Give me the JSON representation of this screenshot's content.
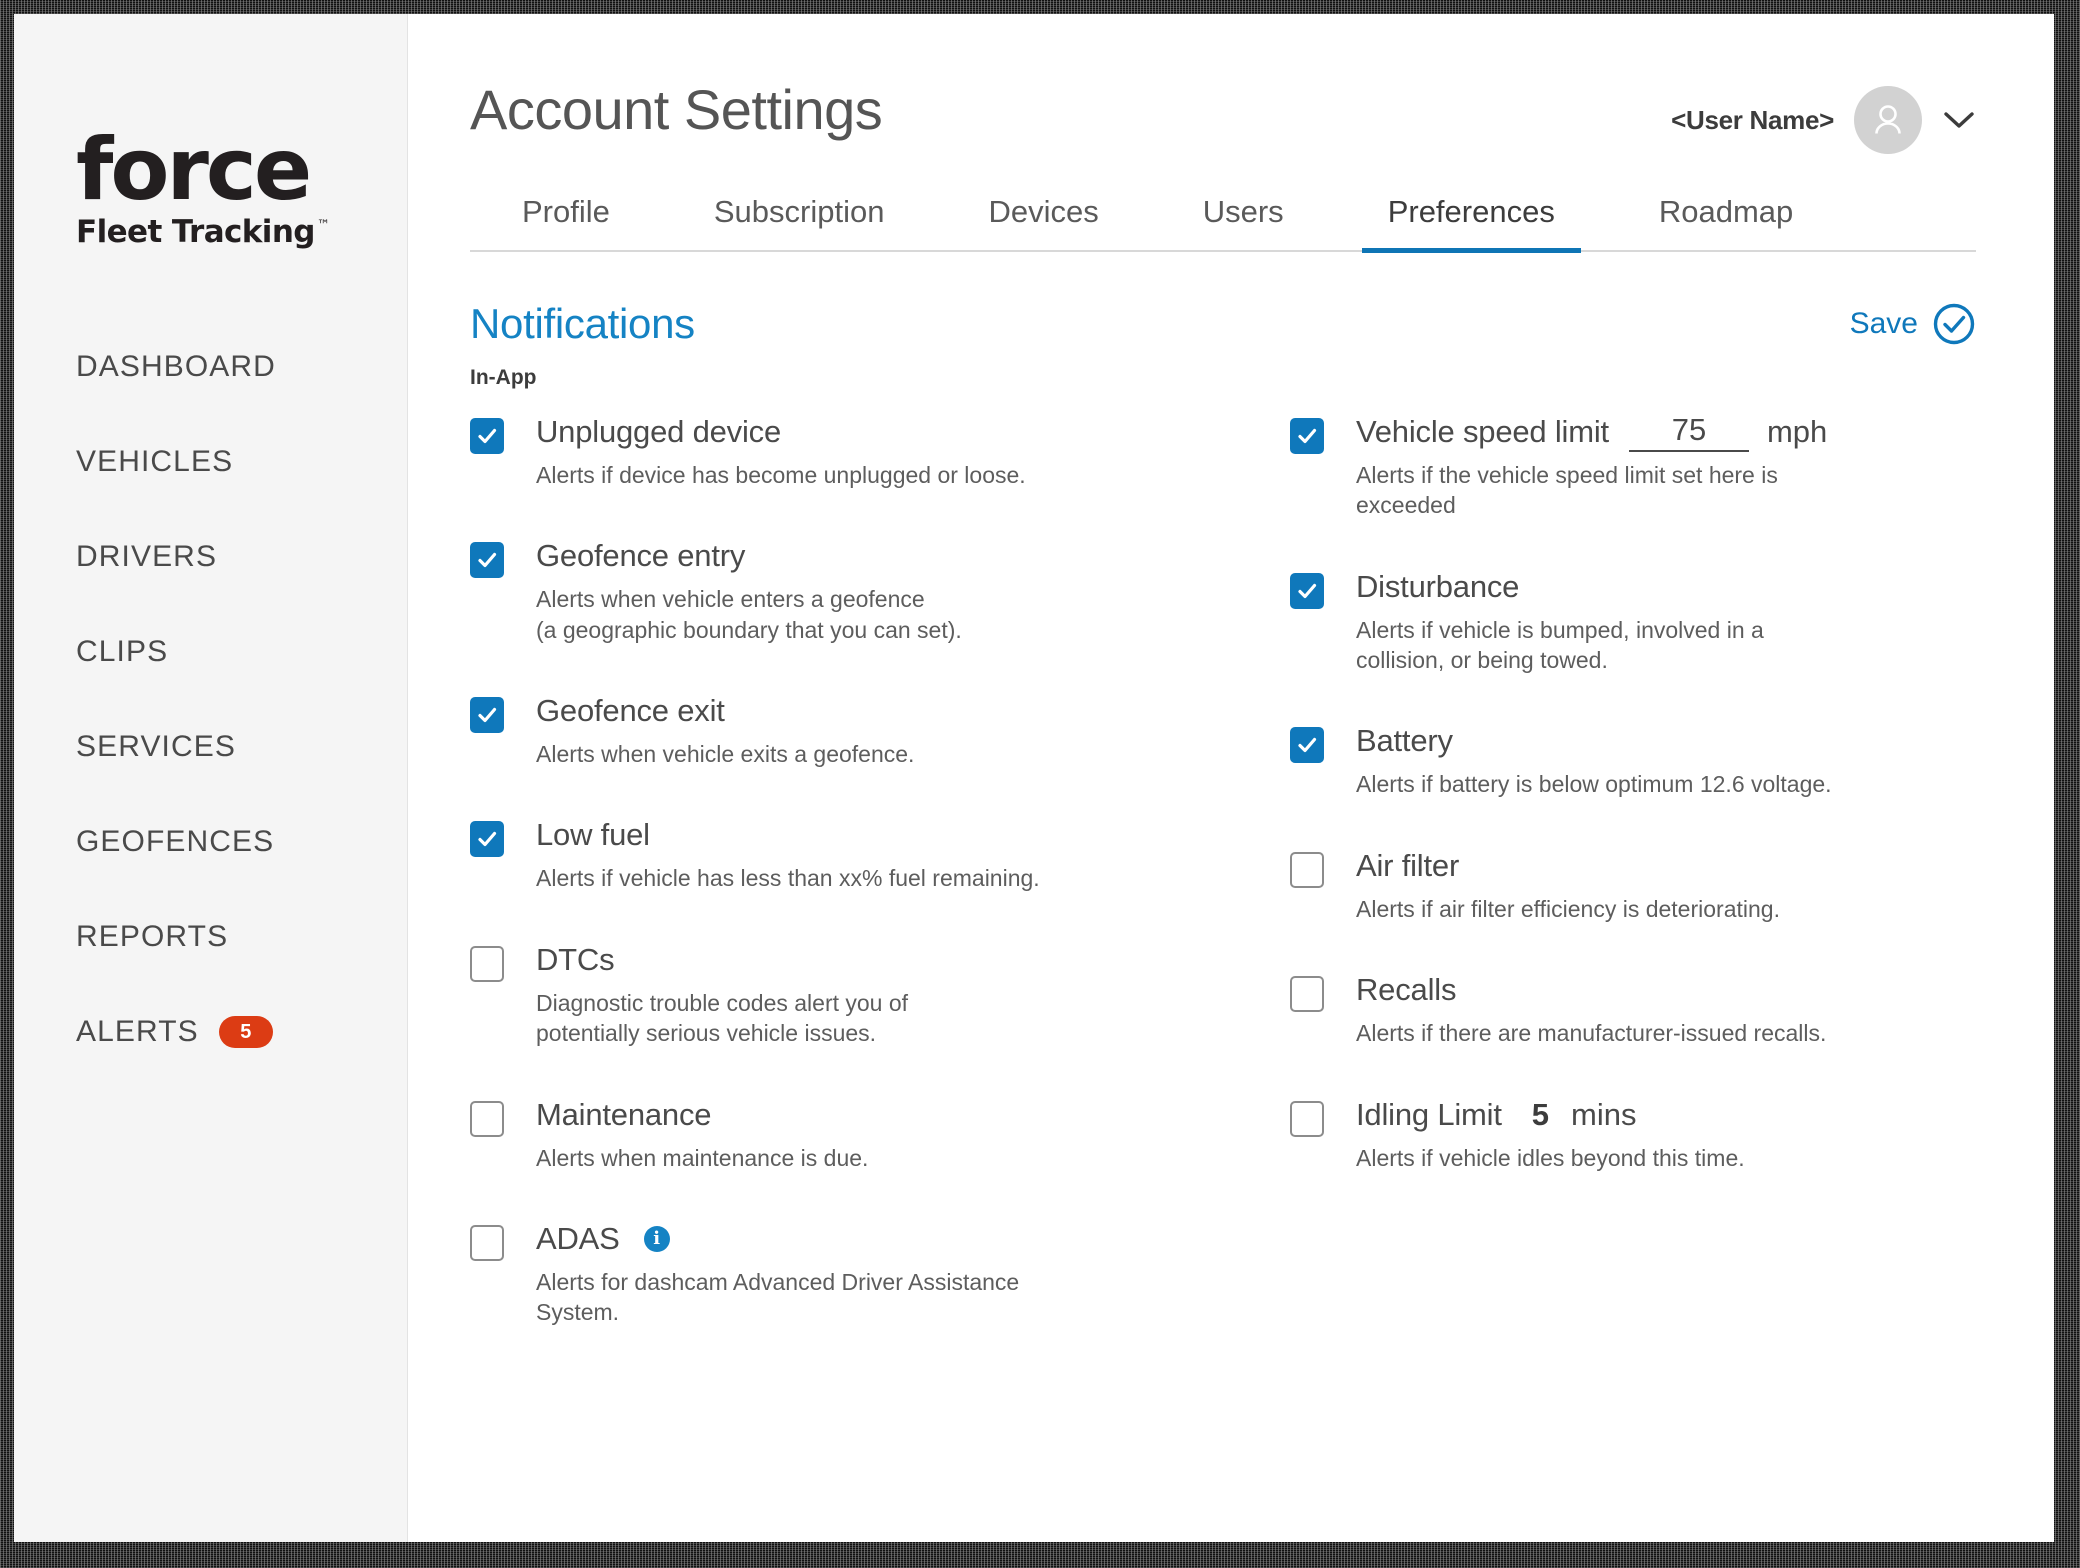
{
  "brand": {
    "logo_word": "force",
    "logo_sub": "Fleet Tracking",
    "logo_tm": "™"
  },
  "sidebar": {
    "items": [
      {
        "label": "DASHBOARD",
        "badge": null
      },
      {
        "label": "VEHICLES",
        "badge": null
      },
      {
        "label": "DRIVERS",
        "badge": null
      },
      {
        "label": "CLIPS",
        "badge": null
      },
      {
        "label": "SERVICES",
        "badge": null
      },
      {
        "label": "GEOFENCES",
        "badge": null
      },
      {
        "label": "REPORTS",
        "badge": null
      },
      {
        "label": "ALERTS",
        "badge": "5"
      }
    ],
    "badge_color": "#dc3c14"
  },
  "header": {
    "title": "Account Settings",
    "user_name": "<User Name>",
    "avatar_icon": "person-icon",
    "chevron_icon": "chevron-down-icon"
  },
  "tabs": [
    {
      "label": "Profile",
      "active": false
    },
    {
      "label": "Subscription",
      "active": false
    },
    {
      "label": "Devices",
      "active": false
    },
    {
      "label": "Users",
      "active": false
    },
    {
      "label": "Preferences",
      "active": true
    },
    {
      "label": "Roadmap",
      "active": false
    }
  ],
  "section": {
    "title": "Notifications",
    "title_color": "#1583c4",
    "subhead": "In-App",
    "save_label": "Save",
    "save_icon": "check-circle-icon",
    "save_color": "#0f78bb"
  },
  "options": {
    "accent_checked": "#0f78bb",
    "left": [
      {
        "label": "Unplugged device",
        "desc": "Alerts if device has become unplugged or loose.",
        "checked": true
      },
      {
        "label": "Geofence entry",
        "desc": "Alerts when vehicle enters a geofence\n(a geographic boundary that you can set).",
        "checked": true
      },
      {
        "label": "Geofence exit",
        "desc": "Alerts when vehicle exits a geofence.",
        "checked": true
      },
      {
        "label": "Low fuel",
        "desc": "Alerts if vehicle has less than xx% fuel remaining.",
        "checked": true
      },
      {
        "label": "DTCs",
        "desc": "Diagnostic trouble codes alert you of\npotentially serious vehicle issues.",
        "checked": false
      },
      {
        "label": "Maintenance",
        "desc": "Alerts when maintenance is due.",
        "checked": false
      },
      {
        "label": "ADAS",
        "desc": "Alerts for dashcam Advanced Driver Assistance\nSystem.",
        "checked": false,
        "info": true
      }
    ],
    "right": [
      {
        "label": "Vehicle speed limit",
        "desc": "Alerts if the vehicle speed limit set here is\nexceeded",
        "checked": true,
        "input_value": "75",
        "unit": "mph"
      },
      {
        "label": "Disturbance",
        "desc": "Alerts if vehicle is bumped, involved in a\ncollision, or being towed.",
        "checked": true
      },
      {
        "label": "Battery",
        "desc": "Alerts if battery is below optimum 12.6 voltage.",
        "checked": true
      },
      {
        "label": "Air filter",
        "desc": "Alerts if air filter efficiency is deteriorating.",
        "checked": false
      },
      {
        "label": "Recalls",
        "desc": "Alerts if there are manufacturer-issued recalls.",
        "checked": false
      },
      {
        "label": "Idling Limit",
        "desc": "Alerts if vehicle idles beyond this time.",
        "checked": false,
        "strong_value": "5",
        "unit": "mins"
      }
    ]
  }
}
